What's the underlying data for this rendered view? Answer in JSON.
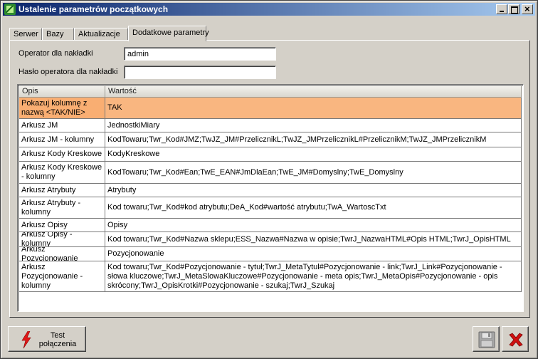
{
  "window": {
    "title": "Ustalenie parametrów początkowych"
  },
  "tabs": [
    {
      "label": "Serwer",
      "active": false
    },
    {
      "label": "Bazy",
      "active": false
    },
    {
      "label": "Aktualizacje",
      "active": false
    },
    {
      "label": "Dodatkowe parametry",
      "active": true
    }
  ],
  "form": {
    "operator_label": "Operator dla nakładki",
    "operator_value": "admin",
    "password_label": "Hasło operatora dla nakładki",
    "password_value": ""
  },
  "grid": {
    "columns": [
      "Opis",
      "Wartość"
    ],
    "rows": [
      {
        "opis": "Pokazuj kolumnę z nazwą <TAK/NIE>",
        "wartosc": "TAK",
        "selected": true
      },
      {
        "opis": "Arkusz JM",
        "wartosc": "JednostkiMiary"
      },
      {
        "opis": "Arkusz JM - kolumny",
        "wartosc": "KodTowaru;Twr_Kod#JMZ;TwJZ_JM#PrzelicznikL;TwJZ_JMPrzelicznikL#PrzelicznikM;TwJZ_JMPrzelicznikM"
      },
      {
        "opis": "Arkusz Kody Kreskowe",
        "wartosc": "KodyKreskowe"
      },
      {
        "opis": "Arkusz Kody Kreskowe - kolumny",
        "wartosc": "KodTowaru;Twr_Kod#Ean;TwE_EAN#JmDlaEan;TwE_JM#Domyslny;TwE_Domyslny"
      },
      {
        "opis": "Arkusz Atrybuty",
        "wartosc": "Atrybuty"
      },
      {
        "opis": "Arkusz Atrybuty - kolumny",
        "wartosc": "Kod towaru;Twr_Kod#kod atrybutu;DeA_Kod#wartość atrybutu;TwA_WartoscTxt"
      },
      {
        "opis": "Arkusz Opisy",
        "wartosc": "Opisy"
      },
      {
        "opis": "Arkusz Opisy - kolumny",
        "wartosc": "Kod towaru;Twr_Kod#Nazwa sklepu;ESS_Nazwa#Nazwa w opisie;TwrJ_NazwaHTML#Opis HTML;TwrJ_OpisHTML"
      },
      {
        "opis": "Arkusz Pozycjonowanie",
        "wartosc": "Pozycjonowanie"
      },
      {
        "opis": "Arkusz Pozycjonowanie - kolumny",
        "wartosc": "Kod towaru;Twr_Kod#Pozycjonowanie - tytuł;TwrJ_MetaTytul#Pozycjonowanie - link;TwrJ_Link#Pozycjonowanie - słowa kluczowe;TwrJ_MetaSlowaKluczowe#Pozycjonowanie - meta opis;TwrJ_MetaOpis#Pozycjonowanie - opis skrócony;TwrJ_OpisKrotki#Pozycjonowanie - szukaj;TwrJ_Szukaj"
      }
    ]
  },
  "buttons": {
    "test_label": "Test połączenia",
    "save_icon": "floppy-disk-icon",
    "cancel_icon": "red-x-icon",
    "test_icon": "lightning-bolt-icon"
  },
  "colors": {
    "selected_row": "#f9b680",
    "title_gradient_start": "#0a246a",
    "cancel_red": "#d01010"
  }
}
